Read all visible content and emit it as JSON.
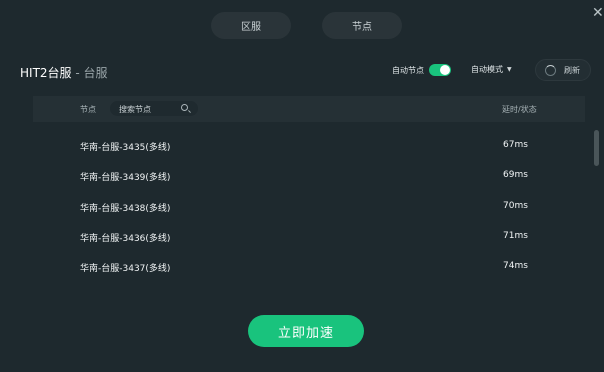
{
  "tabs": {
    "region_label": "区服",
    "node_label": "节点"
  },
  "game": {
    "title": "HIT2台服",
    "separator": " - ",
    "server": "台服"
  },
  "controls": {
    "auto_node_label": "自动节点",
    "auto_node_enabled": true,
    "mode_label": "自动模式",
    "refresh_label": "刷新"
  },
  "table": {
    "header_node": "节点",
    "search_placeholder": "搜索节点",
    "header_latency": "延时/状态",
    "rows": [
      {
        "name": "华南-台服-3435(多线)",
        "latency": "67ms"
      },
      {
        "name": "华南-台服-3439(多线)",
        "latency": "69ms"
      },
      {
        "name": "华南-台服-3438(多线)",
        "latency": "70ms"
      },
      {
        "name": "华南-台服-3436(多线)",
        "latency": "71ms"
      },
      {
        "name": "华南-台服-3437(多线)",
        "latency": "74ms"
      }
    ]
  },
  "action": {
    "accelerate_label": "立即加速"
  },
  "colors": {
    "background": "#1e292e",
    "accent": "#19c37d"
  },
  "icons": {
    "close": "close-icon",
    "search": "search-icon",
    "refresh": "refresh-icon",
    "caret": "chevron-down-icon"
  }
}
